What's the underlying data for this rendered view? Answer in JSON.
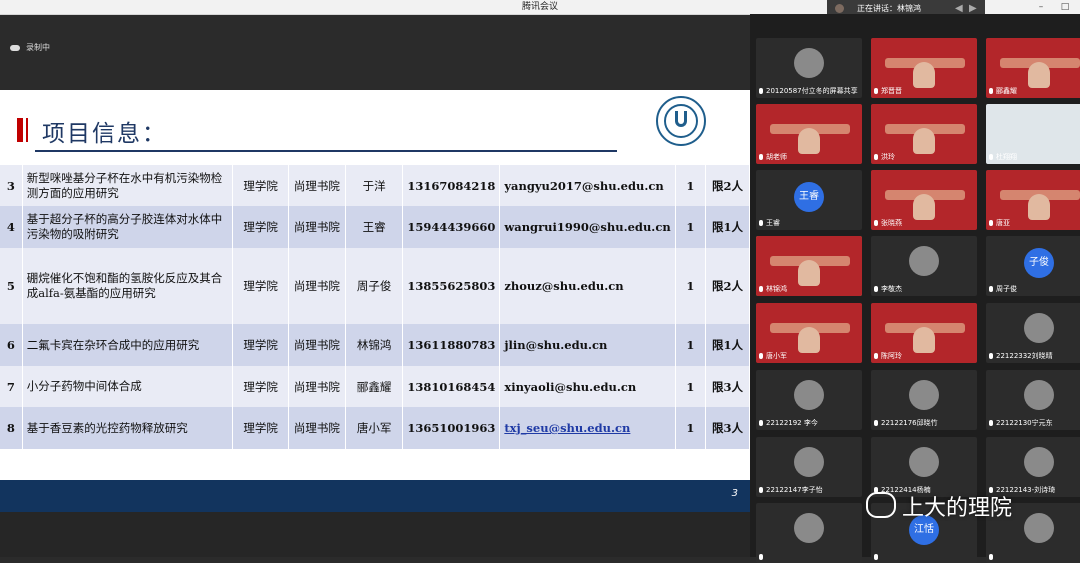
{
  "window": {
    "title": "腾讯会议"
  },
  "speaking": {
    "text": "正在讲话：林锦鸿"
  },
  "recording": {
    "label": "录制中"
  },
  "slide": {
    "title": "项目信息：",
    "page": "3",
    "rows": [
      {
        "no": "3",
        "name": "新型咪唑基分子杯在水中有机污染物检测方面的应用研究",
        "college": "理学院",
        "academy": "尚理书院",
        "tutor": "于洋",
        "phone": "13167084218",
        "email": "yangyu2017@shu.edu.cn",
        "n": "1",
        "limit": "限2人"
      },
      {
        "no": "4",
        "name": "基于超分子杯的高分子胶连体对水体中污染物的吸附研究",
        "college": "理学院",
        "academy": "尚理书院",
        "tutor": "王睿",
        "phone": "15944439660",
        "email": "wangrui1990@shu.edu.cn",
        "n": "1",
        "limit": "限1人"
      },
      {
        "no": "5",
        "name": "硼烷催化不饱和酯的氢胺化反应及其合成alfa-氨基酯的应用研究",
        "college": "理学院",
        "academy": "尚理书院",
        "tutor": "周子俊",
        "phone": "13855625803",
        "email": "zhouz@shu.edu.cn",
        "n": "1",
        "limit": "限2人"
      },
      {
        "no": "6",
        "name": "二氟卡宾在杂环合成中的应用研究",
        "college": "理学院",
        "academy": "尚理书院",
        "tutor": "林锦鸿",
        "phone": "13611880783",
        "email": "jlin@shu.edu.cn",
        "n": "1",
        "limit": "限1人"
      },
      {
        "no": "7",
        "name": "小分子药物中间体合成",
        "college": "理学院",
        "academy": "尚理书院",
        "tutor": "郦鑫耀",
        "phone": "13810168454",
        "email": "xinyaoli@shu.edu.cn",
        "n": "1",
        "limit": "限3人"
      },
      {
        "no": "8",
        "name": "基于香豆素的光控药物释放研究",
        "college": "理学院",
        "academy": "尚理书院",
        "tutor": "唐小军",
        "phone": "13651001963",
        "email": "txj_seu@shu.edu.cn",
        "n": "1",
        "limit": "限3人"
      }
    ]
  },
  "gallery": [
    {
      "label": "20120587付立冬的屏幕共享",
      "kind": "avatar"
    },
    {
      "label": "郑晋晋",
      "kind": "red"
    },
    {
      "label": "郦鑫耀",
      "kind": "red"
    },
    {
      "label": "胡老师",
      "kind": "red"
    },
    {
      "label": "洪玲",
      "kind": "red"
    },
    {
      "label": "杜翔翔",
      "kind": "room"
    },
    {
      "label": "王睿",
      "kind": "text",
      "avatar_text": "王睿"
    },
    {
      "label": "张晓燕",
      "kind": "red"
    },
    {
      "label": "唐亚",
      "kind": "red"
    },
    {
      "label": "林锦鸿",
      "kind": "red",
      "active": true
    },
    {
      "label": "李敬杰",
      "kind": "avatar"
    },
    {
      "label": "周子俊",
      "kind": "text",
      "avatar_text": "子俊"
    },
    {
      "label": "唐小军",
      "kind": "red"
    },
    {
      "label": "陈阿玲",
      "kind": "red"
    },
    {
      "label": "22122332刘晓晴",
      "kind": "avatar"
    },
    {
      "label": "22122192 李今",
      "kind": "avatar"
    },
    {
      "label": "22122176邱晓竹",
      "kind": "avatar"
    },
    {
      "label": "22122130宁元东",
      "kind": "avatar"
    },
    {
      "label": "22122147李子怡",
      "kind": "avatar"
    },
    {
      "label": "22122414杨楠",
      "kind": "avatar"
    },
    {
      "label": "22122143-刘诗琦",
      "kind": "avatar"
    },
    {
      "label": "",
      "kind": "avatar"
    },
    {
      "label": "",
      "kind": "text",
      "avatar_text": "江恬"
    },
    {
      "label": "",
      "kind": "avatar"
    }
  ],
  "watermark": {
    "text": "上大的理院"
  }
}
